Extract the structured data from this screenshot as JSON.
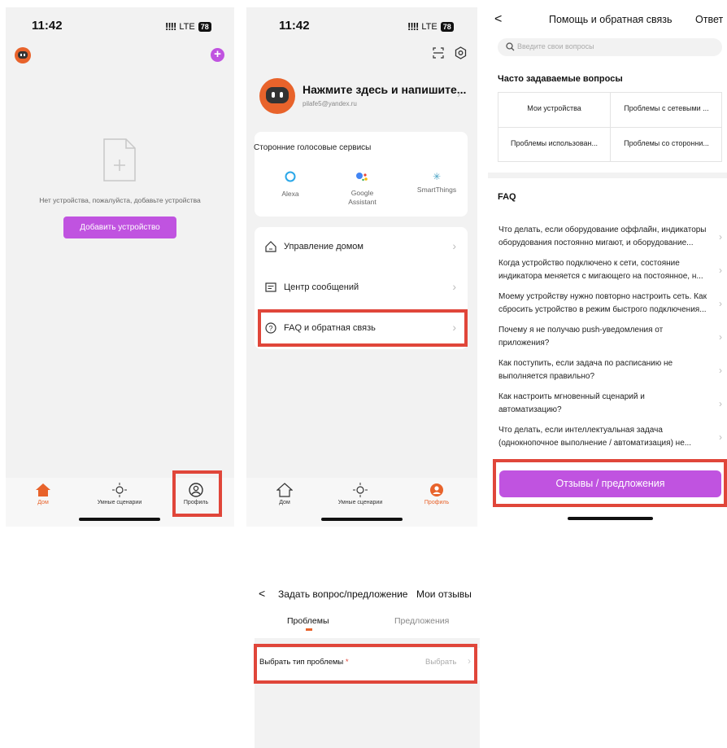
{
  "screen1": {
    "time": "11:42",
    "signal": "!!!!",
    "network": "LTE",
    "battery": "78",
    "empty_message": "Нет устройства, пожалуйста, добавьте устройства",
    "add_device_button": "Добавить устройство",
    "tabs": [
      "Дом",
      "Умные сценарии",
      "Профиль"
    ]
  },
  "screen2": {
    "time": "11:42",
    "signal": "!!!!",
    "network": "LTE",
    "battery": "78",
    "profile_name": "Нажмите здесь и напишите...",
    "profile_email": "pilafe5@yandex.ru",
    "voice_title": "Сторонние голосовые сервисы",
    "voice_services": [
      "Alexa",
      "Google\nAssistant",
      "SmartThings"
    ],
    "menu": [
      "Управление домом",
      "Центр сообщений",
      "FAQ и обратная связь"
    ],
    "tabs": [
      "Дом",
      "Умные сценарии",
      "Профиль"
    ]
  },
  "screen3": {
    "back": "<",
    "title": "Помощь и обратная связь",
    "reply": "Ответ",
    "search_placeholder": "Введите свои вопросы",
    "faq_section": "Часто задаваемые вопросы",
    "categories": [
      "Мои устройства",
      "Проблемы с сетевыми ...",
      "Проблемы использован...",
      "Проблемы со сторонни..."
    ],
    "faq_heading": "FAQ",
    "questions": [
      "Что делать, если оборудование оффлайн, индикаторы оборудования постоянно мигают, и оборудование...",
      "Когда устройство подключено к сети, состояние индикатора меняется с мигающего на постоянное, н...",
      "Моему устройству нужно повторно настроить сеть. Как сбросить устройство в режим быстрого подключения...",
      "Почему я не получаю push-уведомления от приложения?",
      "Как поступить, если задача по расписанию не выполняется правильно?",
      "Как настроить мгновенный сценарий и автоматизацию?",
      "Что делать, если интеллектуальная задача (однокнопочное выполнение / автоматизация) не..."
    ],
    "feedback_button": "Отзывы / предложения"
  },
  "screen4": {
    "back": "<",
    "title": "Задать вопрос/предложение",
    "my_reviews": "Мои отзывы",
    "tab_problems": "Проблемы",
    "tab_suggestions": "Предложения",
    "problem_type_label": "Выбрать тип проблемы",
    "required_mark": "*",
    "select_label": "Выбрать"
  },
  "colors": {
    "accent_purple": "#c053e0",
    "brand_orange": "#e8632b",
    "highlight_red": "#e0463a"
  }
}
